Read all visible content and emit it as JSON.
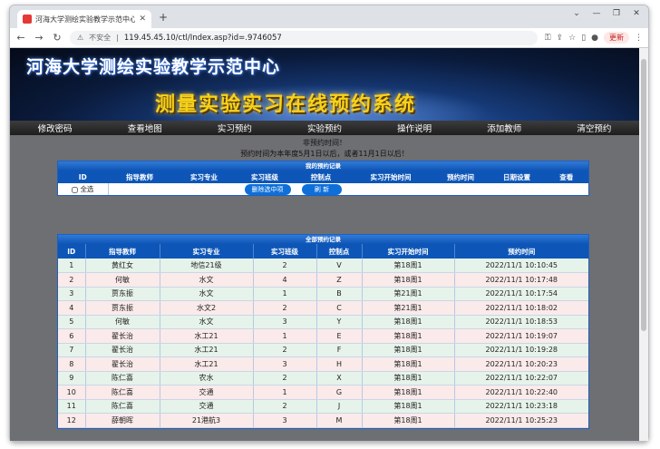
{
  "browser": {
    "tab_title": "河海大学测绘实验教学示范中心",
    "security_label": "不安全",
    "url": "119.45.45.10/ctl/Index.asp?id=.9746057",
    "update_label": "更新"
  },
  "banner": {
    "title": "河海大学测绘实验教学示范中心",
    "subtitle": "测量实验实习在线预约系统"
  },
  "nav": {
    "items": [
      "修改密码",
      "查看地图",
      "实习预约",
      "实验预约",
      "操作说明",
      "添加教师",
      "清空预约"
    ]
  },
  "notice": {
    "line1": "非预约时间！",
    "line2": "预约时间为本年度5月1日以后，或者11月1日以后！"
  },
  "my_records": {
    "title": "我的预约记录",
    "columns": [
      "ID",
      "指导教师",
      "实习专业",
      "实习班级",
      "控制点",
      "实习开始时间",
      "预约时间",
      "日期设置",
      "查看"
    ],
    "select_all_label": "全选",
    "delete_label": "删除选中项",
    "refresh_label": "刷 新"
  },
  "all_records": {
    "title": "全部预约记录",
    "columns": [
      "ID",
      "指导教师",
      "实习专业",
      "实习班级",
      "控制点",
      "实习开始时间",
      "预约时间"
    ],
    "rows": [
      [
        "1",
        "黄红女",
        "地信21级",
        "2",
        "V",
        "第18周1",
        "2022/11/1 10:10:45"
      ],
      [
        "2",
        "何敏",
        "水文",
        "4",
        "Z",
        "第18周1",
        "2022/11/1 10:17:48"
      ],
      [
        "3",
        "贾东振",
        "水文",
        "1",
        "B",
        "第21周1",
        "2022/11/1 10:17:54"
      ],
      [
        "4",
        "贾东振",
        "水文2",
        "2",
        "C",
        "第21周1",
        "2022/11/1 10:18:02"
      ],
      [
        "5",
        "何敏",
        "水文",
        "3",
        "Y",
        "第18周1",
        "2022/11/1 10:18:53"
      ],
      [
        "6",
        "翟长治",
        "水工21",
        "1",
        "E",
        "第18周1",
        "2022/11/1 10:19:07"
      ],
      [
        "7",
        "翟长治",
        "水工21",
        "2",
        "F",
        "第18周1",
        "2022/11/1 10:19:28"
      ],
      [
        "8",
        "翟长治",
        "水工21",
        "3",
        "H",
        "第18周1",
        "2022/11/1 10:20:23"
      ],
      [
        "9",
        "陈仁喜",
        "农水",
        "2",
        "X",
        "第18周1",
        "2022/11/1 10:22:07"
      ],
      [
        "10",
        "陈仁喜",
        "交通",
        "1",
        "G",
        "第18周1",
        "2022/11/1 10:22:40"
      ],
      [
        "11",
        "陈仁喜",
        "交通",
        "2",
        "J",
        "第18周1",
        "2022/11/1 10:23:18"
      ],
      [
        "12",
        "薛朝晖",
        "21港航3",
        "3",
        "M",
        "第18周1",
        "2022/11/1 10:25:23"
      ]
    ]
  }
}
